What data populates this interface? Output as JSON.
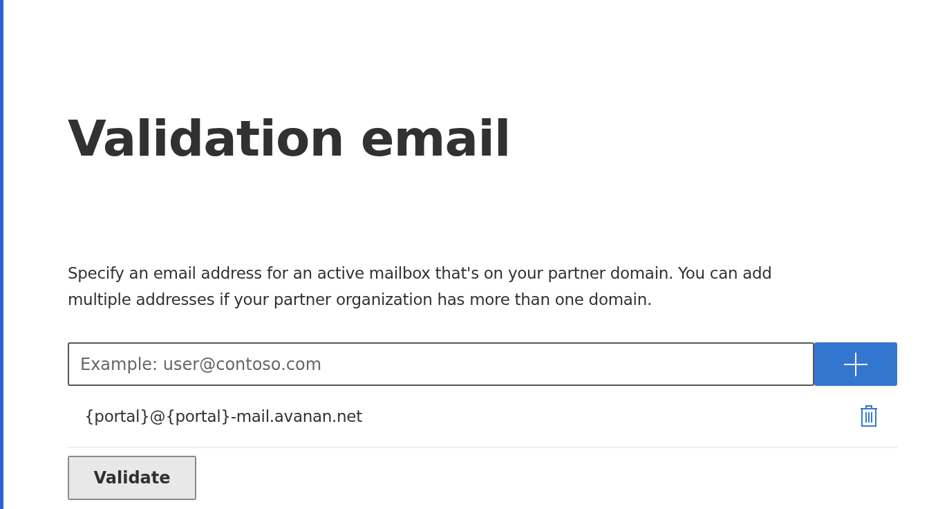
{
  "title": "Validation email",
  "description": "Specify an email address for an active mailbox that's on your partner domain. You can add multiple addresses if your partner organization has more than one domain.",
  "email_field": {
    "placeholder": "Example: user@contoso.com"
  },
  "addresses": [
    {
      "address": "{portal}@{portal}-mail.avanan.net"
    }
  ],
  "buttons": [
    {
      "label": "Validate"
    }
  ]
}
